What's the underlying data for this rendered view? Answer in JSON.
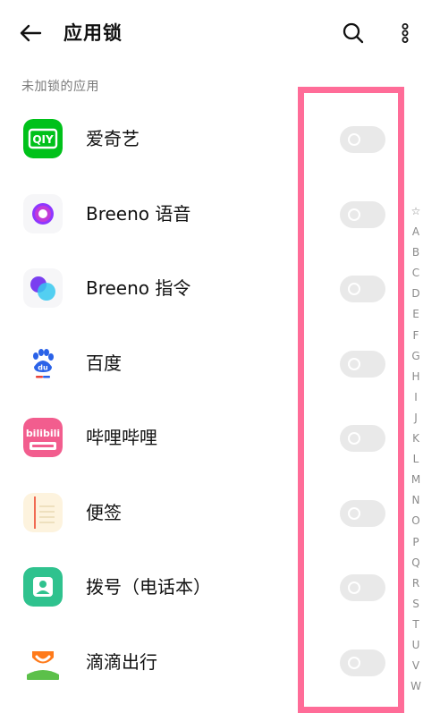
{
  "header": {
    "title": "应用锁",
    "back_icon": "arrow-left-icon",
    "search_icon": "search-icon",
    "more_icon": "more-vertical-icon"
  },
  "section": {
    "label": "未加锁的应用"
  },
  "apps": [
    {
      "name": "爱奇艺",
      "icon": "iqiyi-icon",
      "locked": false
    },
    {
      "name": "Breeno 语音",
      "icon": "breeno-voice-icon",
      "locked": false
    },
    {
      "name": "Breeno 指令",
      "icon": "breeno-command-icon",
      "locked": false
    },
    {
      "name": "百度",
      "icon": "baidu-icon",
      "locked": false
    },
    {
      "name": "哔哩哔哩",
      "icon": "bilibili-icon",
      "locked": false
    },
    {
      "name": "便签",
      "icon": "notes-icon",
      "locked": false
    },
    {
      "name": "拨号（电话本）",
      "icon": "dialer-icon",
      "locked": false
    },
    {
      "name": "滴滴出行",
      "icon": "didi-icon",
      "locked": false
    }
  ],
  "alpha_index": [
    "☆",
    "A",
    "B",
    "C",
    "D",
    "E",
    "F",
    "G",
    "H",
    "I",
    "J",
    "K",
    "L",
    "M",
    "N",
    "O",
    "P",
    "Q",
    "R",
    "S",
    "T",
    "U",
    "V",
    "W"
  ],
  "colors": {
    "highlight": "#ff6c98",
    "toggle_off": "#e9e9e9",
    "secondary_text": "#7a7a7a"
  }
}
